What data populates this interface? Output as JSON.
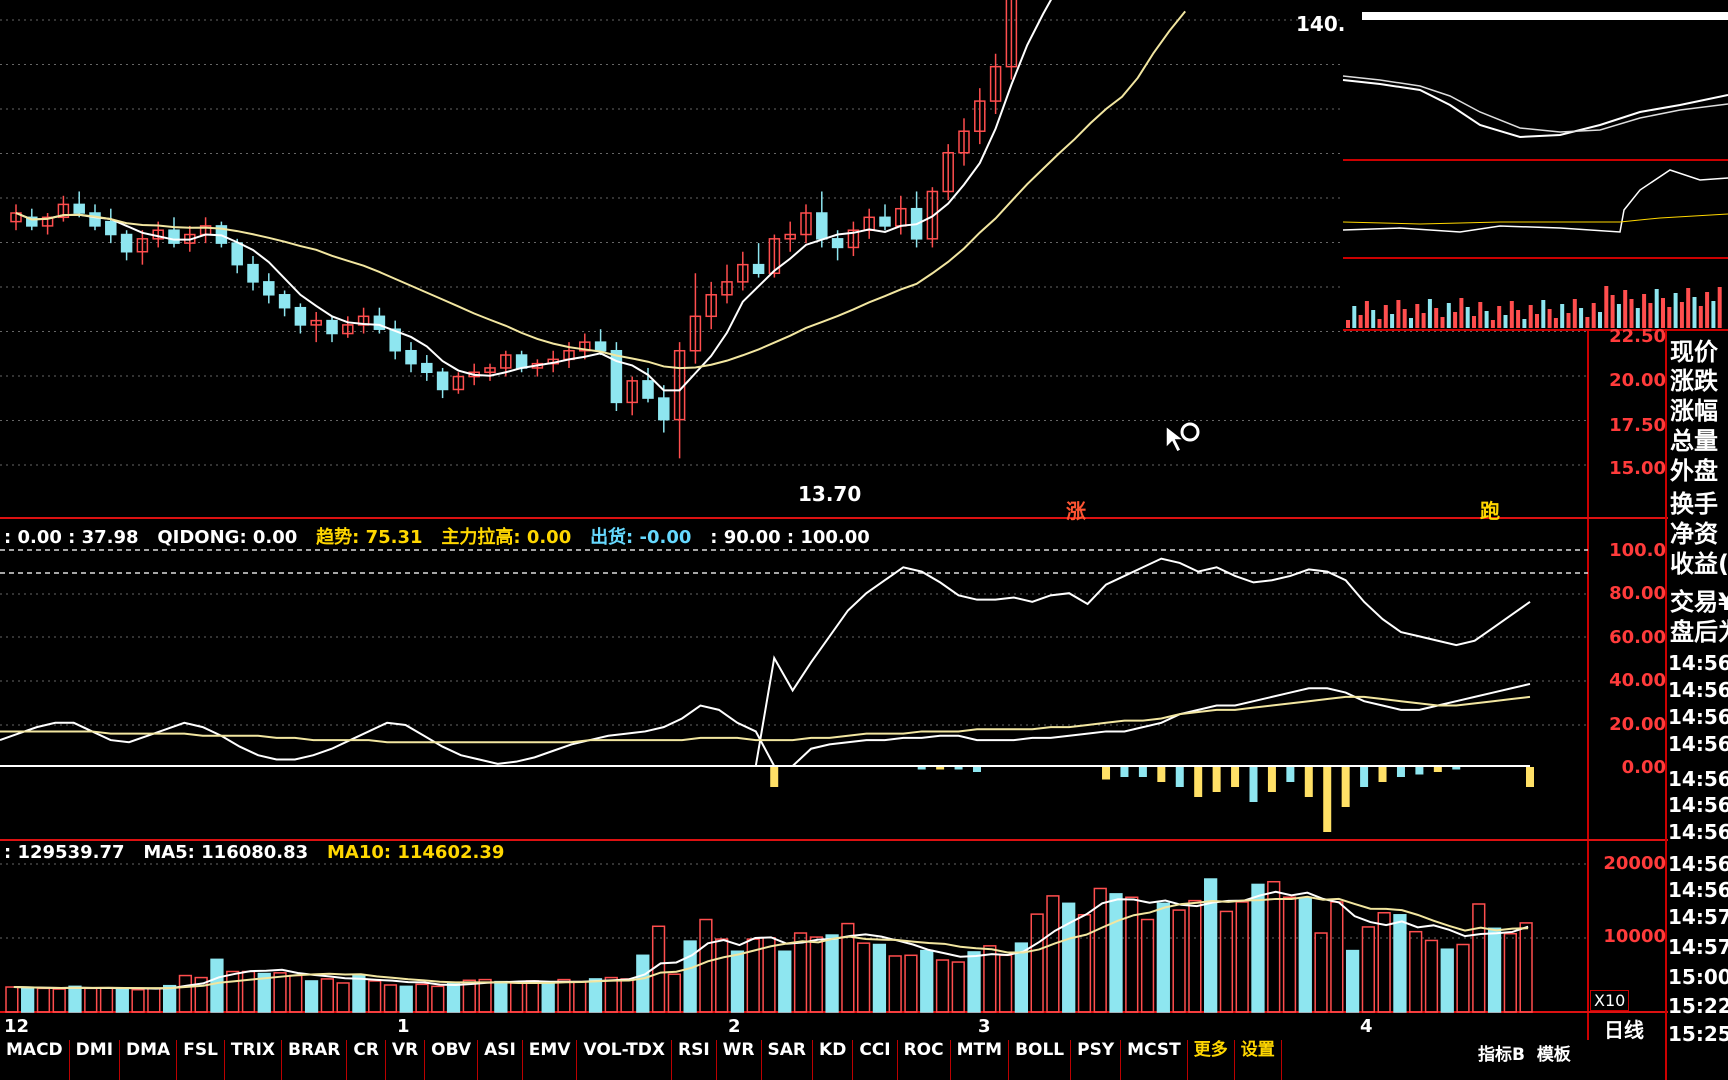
{
  "price_panel": {
    "high_label": "140.",
    "low_label": "13.70",
    "axis_ticks": [
      "22.50",
      "20.00",
      "17.50",
      "15.00"
    ],
    "signal_markers": [
      "涨",
      "跑"
    ]
  },
  "indicator_panel": {
    "header": [
      {
        "label": ": 0.00 : 37.98",
        "color": "#ffffff"
      },
      {
        "label": "QIDONG: 0.00",
        "color": "#ffffff"
      },
      {
        "label": "趋势: 75.31",
        "color": "#ffd700"
      },
      {
        "label": "主力拉高: 0.00",
        "color": "#ffd700"
      },
      {
        "label": "出货: -0.00",
        "color": "#66d9ff"
      },
      {
        "label": ": 90.00 : 100.00",
        "color": "#ffffff"
      }
    ],
    "axis_ticks": [
      "100.0",
      "80.00",
      "60.00",
      "40.00",
      "20.00",
      "0.00"
    ]
  },
  "volume_panel": {
    "header": [
      {
        "label": ": 129539.77",
        "color": "#ffffff"
      },
      {
        "label": "MA5: 116080.83",
        "color": "#ffffff"
      },
      {
        "label": "MA10: 114602.39",
        "color": "#ffd700"
      }
    ],
    "axis_ticks": [
      "20000",
      "10000"
    ],
    "unit_label": "X10"
  },
  "date_axis": [
    "12",
    "1",
    "2",
    "3",
    "4"
  ],
  "period_label": "日线",
  "quote_panel": {
    "labels": [
      "现价",
      "涨跌",
      "涨幅",
      "总量",
      "外盘",
      "换手",
      "净资",
      "收益(",
      "交易¥",
      "盘后为"
    ]
  },
  "tick_times": [
    "14:56",
    "14:56",
    "14:56",
    "14:56",
    "14:56",
    "14:56",
    "14:56",
    "14:56",
    "14:56",
    "14:57",
    "14:57",
    "15:00",
    "15:22",
    "15:25"
  ],
  "tabs": [
    "MACD",
    "DMI",
    "DMA",
    "FSL",
    "TRIX",
    "BRAR",
    "CR",
    "VR",
    "OBV",
    "ASI",
    "EMV",
    "VOL-TDX",
    "RSI",
    "WR",
    "SAR",
    "KD",
    "CCI",
    "ROC",
    "MTM",
    "BOLL",
    "PSY",
    "MCST",
    "更多",
    "设置"
  ],
  "bottom_right_tabs": [
    "指标B",
    "模板"
  ],
  "chart_data": [
    {
      "type": "candlestick",
      "title": "",
      "ylim": [
        12.5,
        24.0
      ],
      "ohlc": [
        [
          19.2,
          19.6,
          19.0,
          19.4
        ],
        [
          19.3,
          19.5,
          19.0,
          19.1
        ],
        [
          19.1,
          19.4,
          18.9,
          19.3
        ],
        [
          19.3,
          19.8,
          19.2,
          19.6
        ],
        [
          19.6,
          19.9,
          19.3,
          19.4
        ],
        [
          19.4,
          19.6,
          19.0,
          19.1
        ],
        [
          19.2,
          19.5,
          18.7,
          18.9
        ],
        [
          18.9,
          19.0,
          18.3,
          18.5
        ],
        [
          18.5,
          19.0,
          18.2,
          18.8
        ],
        [
          18.8,
          19.2,
          18.6,
          19.0
        ],
        [
          19.0,
          19.3,
          18.6,
          18.7
        ],
        [
          18.7,
          19.1,
          18.5,
          18.9
        ],
        [
          18.9,
          19.3,
          18.7,
          19.1
        ],
        [
          19.1,
          19.2,
          18.6,
          18.7
        ],
        [
          18.7,
          18.8,
          18.0,
          18.2
        ],
        [
          18.2,
          18.4,
          17.6,
          17.8
        ],
        [
          17.8,
          18.0,
          17.3,
          17.5
        ],
        [
          17.5,
          17.6,
          17.0,
          17.2
        ],
        [
          17.2,
          17.3,
          16.6,
          16.8
        ],
        [
          16.8,
          17.1,
          16.4,
          16.9
        ],
        [
          16.9,
          17.0,
          16.4,
          16.6
        ],
        [
          16.6,
          17.0,
          16.5,
          16.8
        ],
        [
          16.8,
          17.2,
          16.6,
          17.0
        ],
        [
          17.0,
          17.2,
          16.6,
          16.7
        ],
        [
          16.7,
          16.9,
          16.0,
          16.2
        ],
        [
          16.2,
          16.4,
          15.7,
          15.9
        ],
        [
          15.9,
          16.1,
          15.5,
          15.7
        ],
        [
          15.7,
          15.8,
          15.1,
          15.3
        ],
        [
          15.3,
          15.7,
          15.2,
          15.6
        ],
        [
          15.6,
          15.9,
          15.4,
          15.7
        ],
        [
          15.7,
          15.9,
          15.5,
          15.8
        ],
        [
          15.8,
          16.2,
          15.6,
          16.1
        ],
        [
          16.1,
          16.2,
          15.7,
          15.8
        ],
        [
          15.8,
          16.0,
          15.6,
          15.9
        ],
        [
          15.9,
          16.2,
          15.7,
          16.0
        ],
        [
          16.0,
          16.4,
          15.8,
          16.2
        ],
        [
          16.2,
          16.6,
          16.0,
          16.4
        ],
        [
          16.4,
          16.7,
          16.1,
          16.2
        ],
        [
          16.2,
          16.4,
          14.8,
          15.0
        ],
        [
          15.0,
          15.6,
          14.7,
          15.5
        ],
        [
          15.5,
          15.8,
          15.0,
          15.1
        ],
        [
          15.1,
          15.4,
          14.3,
          14.6
        ],
        [
          14.6,
          16.4,
          13.7,
          16.2
        ],
        [
          16.2,
          18.0,
          15.9,
          17.0
        ],
        [
          17.0,
          17.8,
          16.7,
          17.5
        ],
        [
          17.5,
          18.2,
          17.3,
          17.8
        ],
        [
          17.8,
          18.5,
          17.6,
          18.2
        ],
        [
          18.2,
          18.7,
          17.9,
          18.0
        ],
        [
          18.0,
          18.9,
          17.9,
          18.8
        ],
        [
          18.8,
          19.2,
          18.5,
          18.9
        ],
        [
          18.9,
          19.6,
          18.7,
          19.4
        ],
        [
          19.4,
          19.9,
          18.6,
          18.8
        ],
        [
          18.8,
          19.0,
          18.3,
          18.6
        ],
        [
          18.6,
          19.2,
          18.4,
          19.0
        ],
        [
          19.0,
          19.5,
          18.8,
          19.3
        ],
        [
          19.3,
          19.6,
          19.0,
          19.1
        ],
        [
          19.1,
          19.8,
          18.9,
          19.5
        ],
        [
          19.5,
          19.9,
          18.6,
          18.8
        ],
        [
          18.8,
          20.0,
          18.6,
          19.9
        ],
        [
          19.9,
          21.0,
          19.7,
          20.8
        ],
        [
          20.8,
          21.6,
          20.5,
          21.3
        ],
        [
          21.3,
          22.3,
          21.0,
          22.0
        ],
        [
          22.0,
          23.1,
          21.7,
          22.8
        ],
        [
          22.8,
          25.4,
          22.5,
          25.0
        ],
        [
          25.0,
          26.2,
          24.6,
          25.4
        ],
        [
          25.4,
          26.5,
          24.6,
          24.9
        ],
        [
          24.9,
          25.7,
          24.7,
          25.3
        ],
        [
          25.3,
          25.7,
          24.4,
          24.7
        ],
        [
          24.7,
          26.4,
          24.5,
          26.2
        ],
        [
          26.2,
          27.3,
          25.3,
          25.6
        ],
        [
          25.6,
          26.3,
          24.7,
          25.0
        ],
        [
          25.0,
          27.8,
          24.7,
          27.6
        ],
        [
          27.6,
          30.5,
          27.3,
          30.2
        ],
        [
          30.2,
          31.3,
          28.8,
          29.2
        ],
        [
          29.2,
          29.6,
          28.0,
          28.4
        ]
      ]
    },
    {
      "type": "line",
      "title": "",
      "ylim": [
        0,
        100
      ],
      "series": [
        {
          "values": [
            0,
            0,
            0,
            0,
            0,
            0,
            0,
            0,
            0,
            0,
            0,
            0,
            0,
            0,
            0,
            0,
            0,
            0,
            0,
            0,
            0,
            0,
            0,
            0,
            0,
            0,
            0,
            0,
            0,
            0,
            0,
            0,
            0,
            0,
            0,
            0,
            0,
            0,
            0,
            0,
            0,
            0,
            50,
            35,
            48,
            60,
            72,
            80,
            86,
            92,
            90,
            85,
            79,
            77,
            77,
            78,
            76,
            79,
            80,
            75,
            84,
            88,
            92,
            96,
            94,
            90,
            92,
            88,
            85,
            86,
            88,
            91,
            90,
            86,
            76,
            68,
            62,
            60,
            58,
            56,
            58,
            64,
            70,
            76
          ]
        },
        {
          "values": [
            12,
            15,
            18,
            20,
            20,
            16,
            12,
            11,
            14,
            17,
            20,
            18,
            14,
            9,
            5,
            3,
            3,
            5,
            8,
            12,
            16,
            20,
            19,
            14,
            9,
            5,
            3,
            1,
            2,
            4,
            7,
            10,
            12,
            14,
            15,
            16,
            18,
            22,
            28,
            26,
            20,
            16,
            0,
            0,
            8,
            10,
            11,
            12,
            12,
            13,
            13,
            14,
            14,
            12,
            12,
            12,
            13,
            13,
            14,
            15,
            16,
            16,
            18,
            20,
            24,
            26,
            28,
            28,
            30,
            32,
            34,
            36,
            36,
            34,
            30,
            28,
            26,
            26,
            28,
            30,
            32,
            34,
            36,
            38
          ]
        },
        {
          "values": [
            16,
            16,
            16,
            16,
            16,
            16,
            15,
            15,
            15,
            15,
            15,
            14,
            14,
            14,
            14,
            13,
            13,
            12,
            12,
            12,
            12,
            11,
            11,
            11,
            11,
            11,
            11,
            11,
            11,
            11,
            11,
            11,
            12,
            12,
            12,
            12,
            12,
            12,
            13,
            13,
            13,
            12,
            12,
            12,
            13,
            13,
            14,
            15,
            15,
            15,
            16,
            16,
            16,
            17,
            17,
            17,
            17,
            18,
            18,
            19,
            20,
            21,
            21,
            22,
            24,
            25,
            26,
            26,
            27,
            28,
            29,
            30,
            31,
            32,
            32,
            31,
            30,
            29,
            28,
            28,
            29,
            30,
            31,
            32
          ]
        }
      ],
      "histogram": [
        0,
        0,
        0,
        0,
        0,
        0,
        0,
        0,
        0,
        0,
        0,
        0,
        0,
        0,
        0,
        0,
        0,
        0,
        0,
        0,
        0,
        0,
        0,
        0,
        0,
        0,
        0,
        0,
        0,
        0,
        0,
        0,
        0,
        0,
        0,
        0,
        0,
        0,
        0,
        0,
        0,
        0,
        -8,
        0,
        0,
        0,
        0,
        0,
        0,
        0,
        -1,
        -1,
        -1,
        -2,
        0,
        0,
        0,
        0,
        0,
        0,
        -5,
        -4,
        -4,
        -6,
        -8,
        -12,
        -10,
        -8,
        -14,
        -10,
        -6,
        -12,
        -26,
        -16,
        -8,
        -6,
        -4,
        -3,
        -2,
        -1,
        0,
        0,
        0,
        -8
      ]
    },
    {
      "type": "bar",
      "title": "",
      "ylim": [
        0,
        24000
      ],
      "values": [
        3700,
        3600,
        3500,
        3400,
        3800,
        3500,
        3600,
        3400,
        3300,
        3500,
        3900,
        5400,
        5100,
        7800,
        6000,
        6000,
        5700,
        5800,
        5400,
        4600,
        4900,
        4300,
        5400,
        4600,
        4000,
        3800,
        4100,
        3800,
        4300,
        4700,
        4800,
        4500,
        4300,
        4600,
        4200,
        4800,
        4500,
        4900,
        5100,
        4900,
        8400,
        12700,
        5600,
        10500,
        13700,
        10800,
        9000,
        10800,
        11000,
        9000,
        11700,
        11100,
        11400,
        13100,
        10200,
        10000,
        8300,
        8400,
        9100,
        7700,
        7400,
        8900,
        9800,
        8400,
        10200,
        14500,
        17200,
        16100,
        14400,
        18300,
        17500,
        17000,
        13700,
        16100,
        15100,
        16500,
        19700,
        14900,
        16300,
        18900,
        19300,
        17000,
        16900,
        11700,
        16300,
        9100,
        12600,
        14700,
        14400,
        11900,
        10600,
        9300,
        10000,
        16000,
        12400,
        11600,
        13200
      ]
    }
  ]
}
